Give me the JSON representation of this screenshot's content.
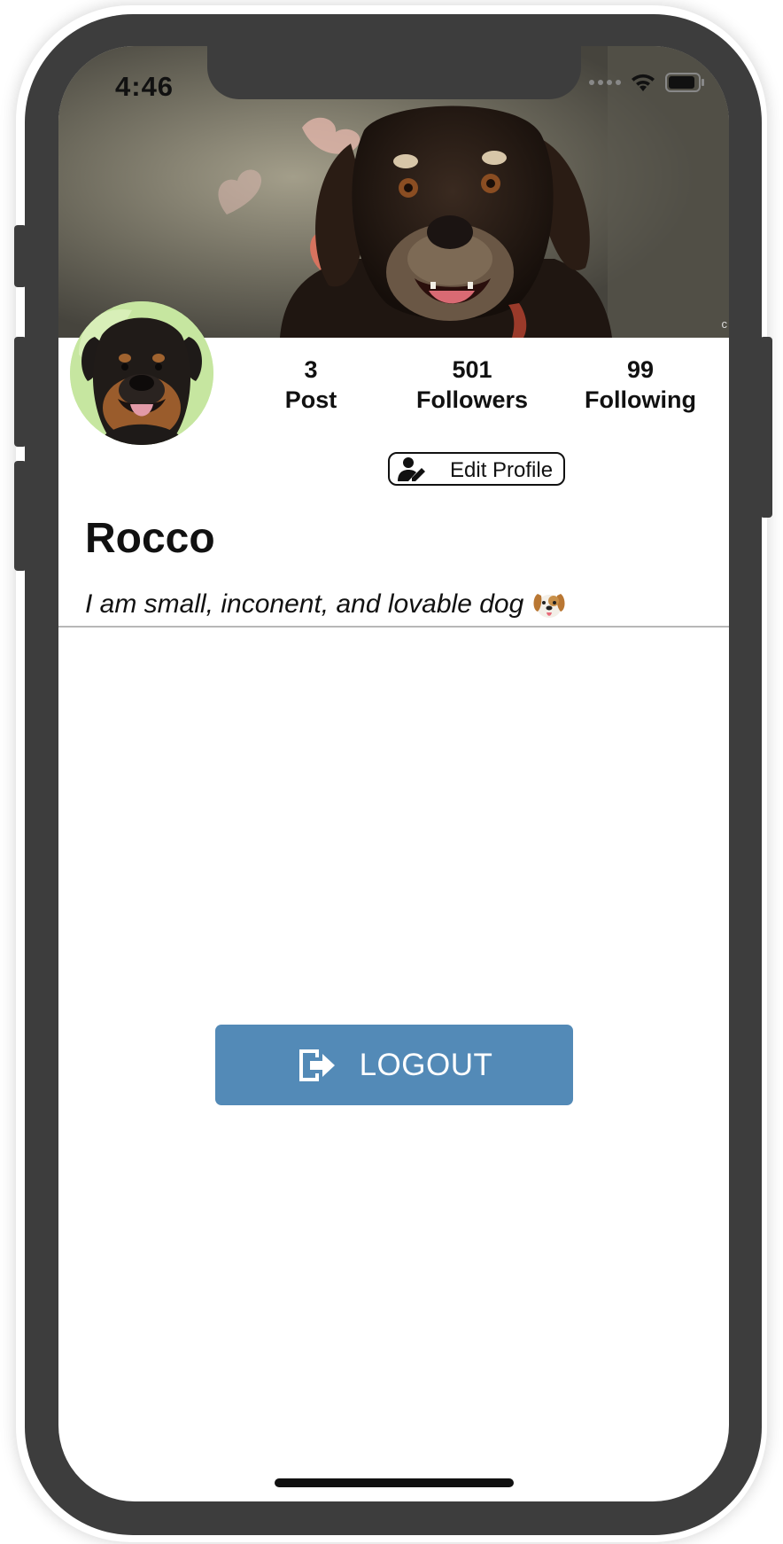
{
  "status_bar": {
    "time": "4:46",
    "icons": [
      "signal-dots-icon",
      "wifi-icon",
      "battery-icon"
    ]
  },
  "cover": {
    "credit": "c"
  },
  "profile": {
    "name": "Rocco",
    "bio": "I am small, inconent, and lovable dog",
    "bio_emoji": "dog-face-emoji"
  },
  "stats": [
    {
      "value": "3",
      "label": "Post"
    },
    {
      "value": "501",
      "label": "Followers"
    },
    {
      "value": "99",
      "label": "Following"
    }
  ],
  "edit_profile": {
    "label": "Edit Profile",
    "icon": "user-edit-icon"
  },
  "logout": {
    "label": "LOGOUT",
    "icon": "sign-out-icon",
    "color": "#538ab7"
  },
  "colors": {
    "device": "#3d3d3d",
    "divider": "#b7b7b7",
    "logout_button": "#538ab7"
  }
}
